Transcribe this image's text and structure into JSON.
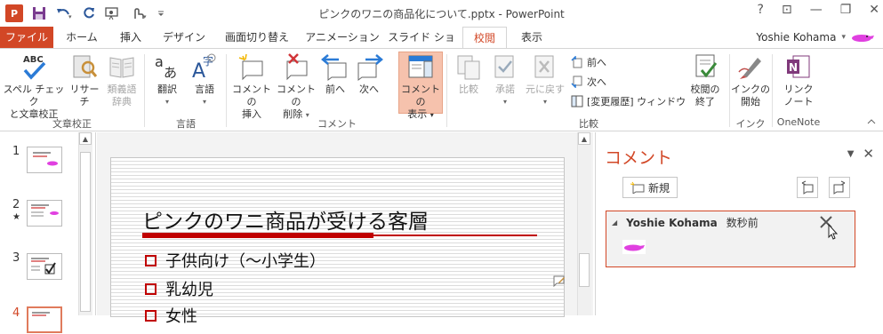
{
  "window": {
    "title": "ピンクのワニの商品化について.pptx - PowerPoint",
    "controls": [
      "?",
      "⊡",
      "—",
      "❐",
      "✕"
    ]
  },
  "tabs": [
    {
      "label": "ファイル"
    },
    {
      "label": "ホーム"
    },
    {
      "label": "挿入"
    },
    {
      "label": "デザイン"
    },
    {
      "label": "画面切り替え"
    },
    {
      "label": "アニメーション"
    },
    {
      "label": "スライド ショー"
    },
    {
      "label": "校閲"
    },
    {
      "label": "表示"
    }
  ],
  "user": {
    "name": "Yoshie Kohama",
    "caret": "▾"
  },
  "ribbon": {
    "spelling": {
      "line1": "スペル チェック",
      "line2": "と文章校正",
      "icon_text": "ABC"
    },
    "research": {
      "label": "リサーチ"
    },
    "thesaurus": {
      "line1": "類義語",
      "line2": "辞典"
    },
    "group_proofing": "文章校正",
    "translate": {
      "label": "翻訳"
    },
    "language": {
      "label": "言語"
    },
    "group_language": "言語",
    "new_comment": {
      "line1": "コメントの",
      "line2": "挿入"
    },
    "delete_comment": {
      "line1": "コメントの",
      "line2": "削除"
    },
    "previous": {
      "label": "前へ"
    },
    "next": {
      "label": "次へ"
    },
    "show_comments": {
      "line1": "コメントの",
      "line2": "表示"
    },
    "group_comments": "コメント",
    "compare": {
      "label": "比較"
    },
    "accept": {
      "label": "承諾"
    },
    "reject": {
      "label": "元に戻す"
    },
    "prev_small": "前へ",
    "next_small": "次へ",
    "reviewing_pane": "[変更履歴] ウィンドウ",
    "end_review": {
      "line1": "校閲の",
      "line2": "終了"
    },
    "group_compare": "比較",
    "start_inking": {
      "line1": "インクの",
      "line2": "開始"
    },
    "group_ink": "インク",
    "linked_notes": {
      "line1": "リンク",
      "line2": "ノート"
    },
    "group_onenote": "OneNote"
  },
  "slides": [
    {
      "number": "1",
      "star": ""
    },
    {
      "number": "2",
      "star": "★"
    },
    {
      "number": "3",
      "star": ""
    },
    {
      "number": "4",
      "star": ""
    }
  ],
  "slide": {
    "title": "ピンクのワニ商品が受ける客層",
    "bullets": [
      "子供向け（～小学生）",
      "乳幼児",
      "女性"
    ]
  },
  "comments_pane": {
    "title": "コメント",
    "new_label": "新規",
    "comment": {
      "author": "Yoshie Kohama",
      "time": "数秒前"
    }
  },
  "colors": {
    "accent": "#d24726",
    "title_red": "#c00000",
    "ink_pink": "#e040e0"
  }
}
